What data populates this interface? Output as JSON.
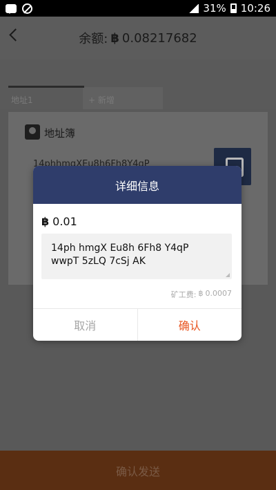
{
  "status_bar": {
    "battery": "31%",
    "time": "10:26"
  },
  "header": {
    "balance_label": "余额:",
    "currency_symbol": "฿",
    "balance": "0.08217682"
  },
  "tabs": {
    "tab1": "地址1",
    "add": "+ 新增"
  },
  "address_book": {
    "label": "地址簿",
    "partial_address": "14phhmgXEu8h6Fh8Y4qP"
  },
  "footer": {
    "confirm_send_label": "确认发送"
  },
  "dialog": {
    "title": "详细信息",
    "currency_symbol": "฿",
    "amount": "0.01",
    "address_line1": "14ph hmgX Eu8h 6Fh8 Y4qP",
    "address_line2": "wwpT 5zLQ 7cSj AK",
    "fee_label": "矿工费:",
    "fee_value": "0.0007",
    "cancel_label": "取消",
    "confirm_label": "确认"
  },
  "colors": {
    "dialog_header": "#2f3d6b",
    "confirm": "#e8541f",
    "footer": "#5a2e12"
  }
}
